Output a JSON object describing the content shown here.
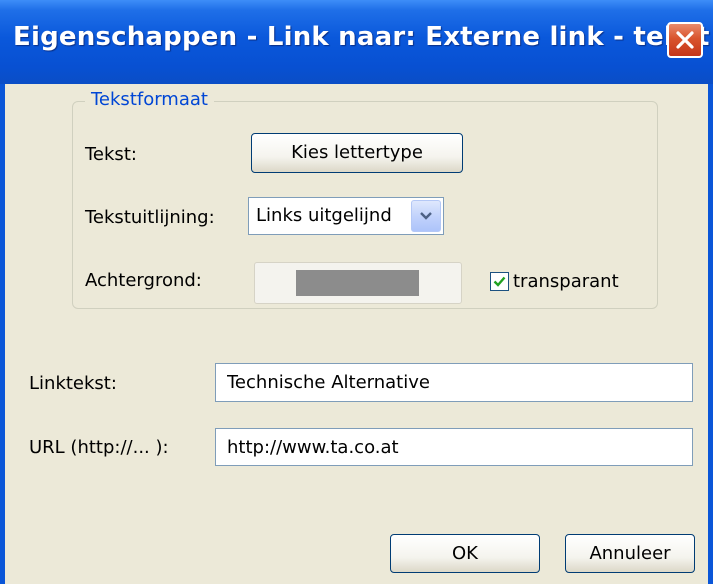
{
  "window": {
    "title": "Eigenschappen - Link naar: Externe link - tekst"
  },
  "group": {
    "legend": "Tekstformaat",
    "text_label": "Tekst:",
    "font_button": "Kies lettertype",
    "alignment_label": "Tekstuitlijning:",
    "alignment_value": "Links uitgelijnd",
    "background_label": "Achtergrond:",
    "background_color": "#8c8c8c",
    "transparent_label": "transparant",
    "transparent_checked": true
  },
  "form": {
    "linktext_label": "Linktekst:",
    "linktext_value": "Technische Alternative",
    "url_label": "URL (http://... ):",
    "url_value": "http://www.ta.co.at"
  },
  "buttons": {
    "ok": "OK",
    "cancel": "Annuleer"
  },
  "colors": {
    "titlebar": "#0a58db",
    "dialog_background": "#ece9d8",
    "group_legend": "#0046d5",
    "close_button": "#d9542d",
    "checkmark": "#21a121"
  }
}
